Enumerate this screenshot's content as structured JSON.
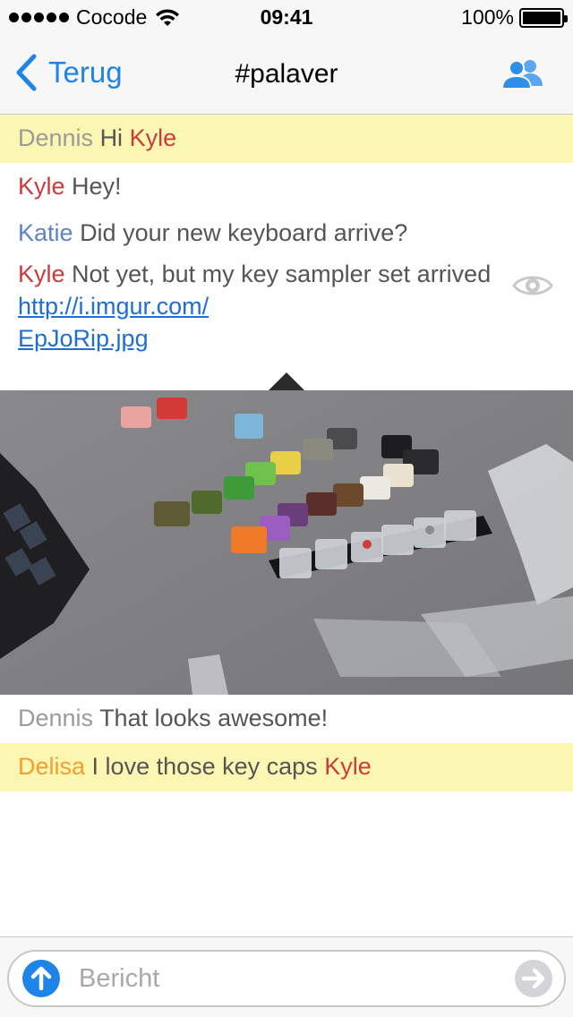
{
  "status_bar": {
    "carrier": "Cocode",
    "time": "09:41",
    "battery": "100%",
    "battery_level": 1.0
  },
  "nav": {
    "back_label": "Terug",
    "title": "#palaver"
  },
  "messages": [
    {
      "nick": "Dennis",
      "text": "Hi",
      "mention": "Kyle",
      "highlighted": true
    },
    {
      "nick": "Kyle",
      "text": "Hey!"
    },
    {
      "nick": "Katie",
      "text": "Did your new keyboard arrive?"
    },
    {
      "nick": "Kyle",
      "text": "Not yet, but my key sampler set arrived",
      "link": "http://i.imgur.com/EpJoRip.jpg",
      "link_line1": "http://i.imgur.com/",
      "link_line2": "EpJoRip.jpg"
    },
    {
      "nick": "Dennis",
      "text": "That looks awesome!"
    },
    {
      "nick": "Delisa",
      "text": "I love those key caps",
      "mention": "Kyle",
      "highlighted": true
    }
  ],
  "colors": {
    "accent": "#1f84e8",
    "highlight_bg": "#fbf7b3",
    "nick_dennis": "#9b9b9b",
    "nick_kyle": "#cc3b3b",
    "nick_katie": "#5b84c4",
    "nick_delisa": "#f0a033",
    "link": "#1f6fd1"
  },
  "icons": {
    "back": "chevron-left-icon",
    "users": "users-icon",
    "preview_toggle": "eye-icon",
    "upload": "arrow-up-icon",
    "send": "arrow-right-icon"
  },
  "input": {
    "placeholder": "Bericht"
  }
}
